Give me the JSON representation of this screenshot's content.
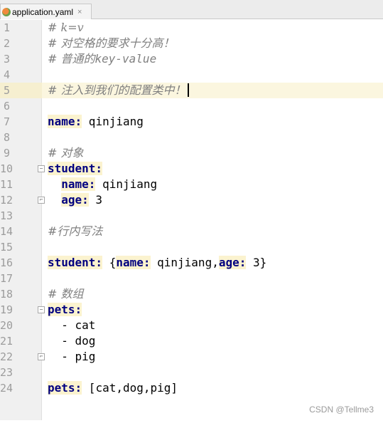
{
  "tab": {
    "label": "application.yaml",
    "close": "×"
  },
  "lines": [
    {
      "num": "1",
      "comment": "# k=v"
    },
    {
      "num": "2",
      "comment": "# 对空格的要求十分高！"
    },
    {
      "num": "3",
      "comment_prefix": "# 普通的",
      "comment_mono": "key-value"
    },
    {
      "num": "4"
    },
    {
      "num": "5",
      "comment": "# 注入到我们的配置类中！",
      "current": true
    },
    {
      "num": "6"
    },
    {
      "num": "7",
      "key": "name:",
      "value": " qinjiang"
    },
    {
      "num": "8"
    },
    {
      "num": "9",
      "comment": "# 对象"
    },
    {
      "num": "10",
      "key": "student:",
      "fold": "−"
    },
    {
      "num": "11",
      "indent": "  ",
      "key": "name:",
      "value": " qinjiang"
    },
    {
      "num": "12",
      "indent": "  ",
      "key": "age:",
      "value": " 3",
      "fold": "⌐"
    },
    {
      "num": "13"
    },
    {
      "num": "14",
      "comment": "#行内写法"
    },
    {
      "num": "15"
    },
    {
      "num": "16",
      "key": "student:",
      "p1": " {",
      "key2": "name:",
      "p2": " qinjiang,",
      "key3": "age:",
      "p3": " 3}"
    },
    {
      "num": "17"
    },
    {
      "num": "18",
      "comment": "# 数组"
    },
    {
      "num": "19",
      "key": "pets:",
      "fold": "−"
    },
    {
      "num": "20",
      "value": "  - cat"
    },
    {
      "num": "21",
      "value": "  - dog"
    },
    {
      "num": "22",
      "value": "  - pig",
      "fold": "⌐"
    },
    {
      "num": "23"
    },
    {
      "num": "24",
      "key": "pets:",
      "value": " [cat,dog,pig]"
    }
  ],
  "watermark": "CSDN @Tellme3"
}
